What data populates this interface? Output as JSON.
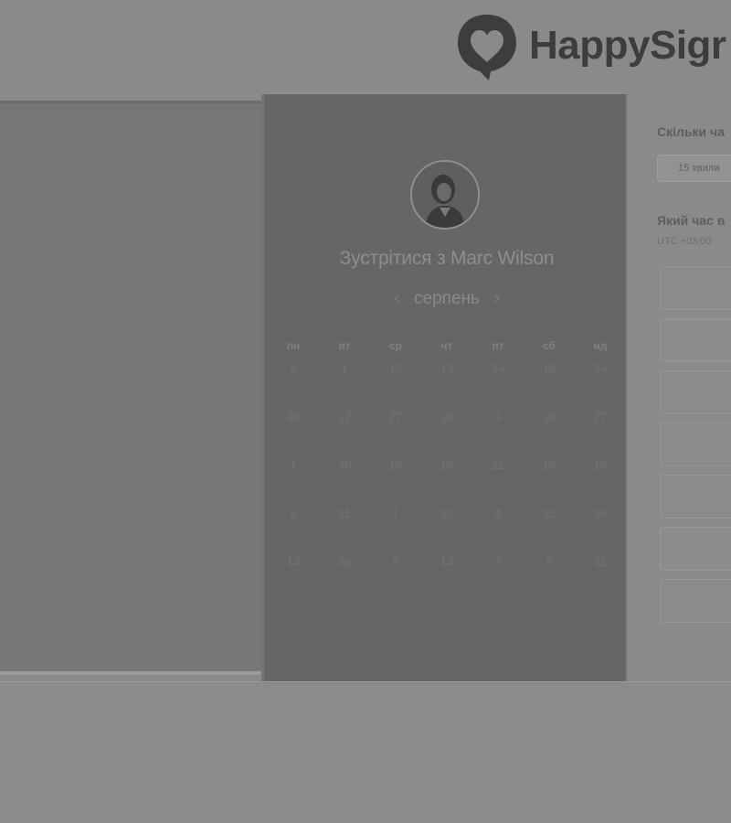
{
  "brand": {
    "name": "HappySigr"
  },
  "scheduler": {
    "title": "Зустрітися з Marc Wilson",
    "month": "серпень",
    "prev_icon": "‹",
    "next_icon": "›",
    "weekdays": [
      "пн",
      "вт",
      "ср",
      "чт",
      "пт",
      "сб",
      "нд"
    ],
    "weeks": [
      [
        "9",
        "1",
        "12",
        "13",
        "24",
        "18",
        "24"
      ],
      [
        "30",
        "12",
        "27",
        "10",
        "4",
        "19",
        "27"
      ],
      [
        "1",
        "30",
        "16",
        "16",
        "22",
        "16",
        "16"
      ],
      [
        "6",
        "21",
        "7",
        "20",
        "4",
        "15",
        "26"
      ],
      [
        "14",
        "26",
        "9",
        "14",
        "3",
        "6",
        "11"
      ]
    ]
  },
  "settings": {
    "duration_question": "Скільки ча",
    "duration_value": "15 хвили",
    "time_question": "Який час в",
    "timezone": "UTC +03:00"
  }
}
